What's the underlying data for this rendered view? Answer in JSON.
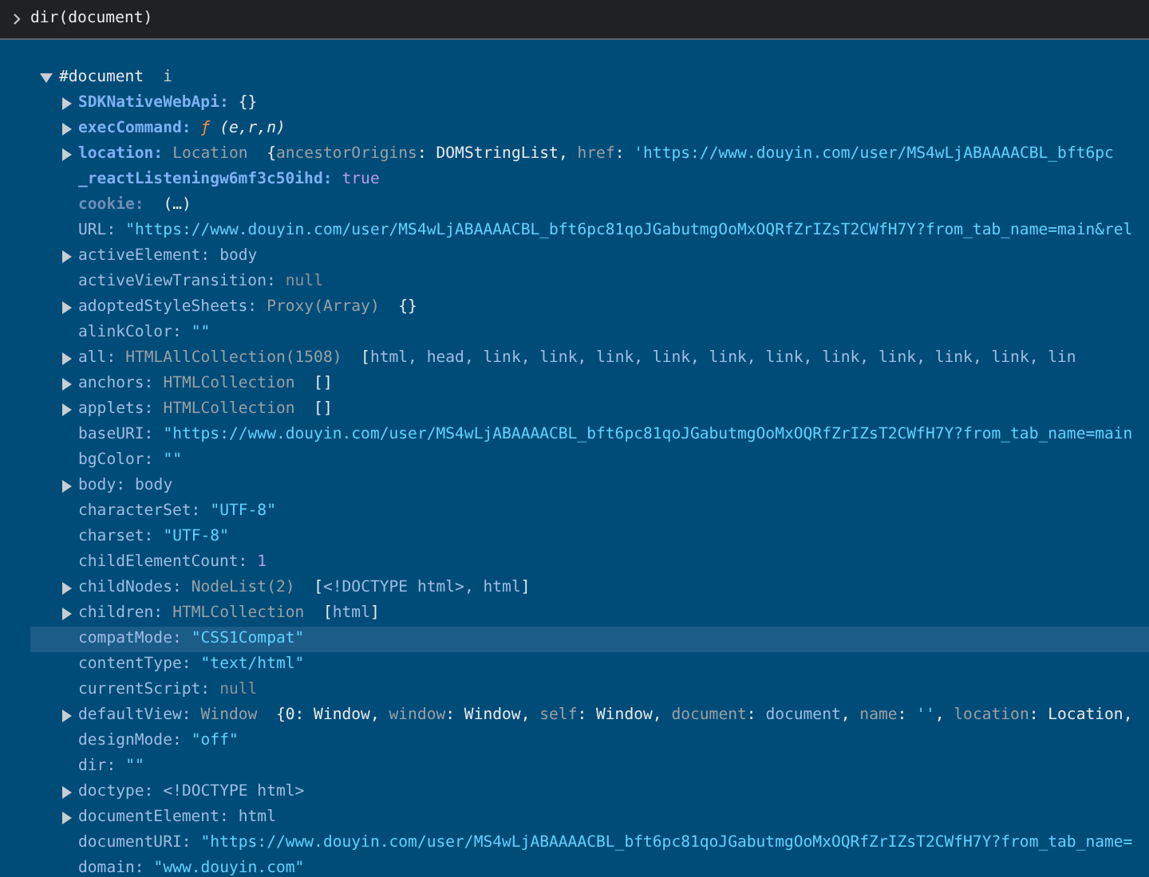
{
  "console_input": {
    "text": "dir(document)"
  },
  "root": {
    "label": "#document",
    "info": "i",
    "expanded": true,
    "properties": [
      {
        "key": "SDKNativeWebApi:",
        "kind": "own",
        "expandable": true,
        "selected": false,
        "value": [
          {
            "kind": "text",
            "text": "{}"
          }
        ]
      },
      {
        "key": "execCommand:",
        "kind": "own",
        "expandable": true,
        "selected": false,
        "value": [
          {
            "kind": "fn",
            "text": "ƒ"
          },
          {
            "kind": "params",
            "text": " (e,r,n)"
          }
        ]
      },
      {
        "key": "location:",
        "kind": "own",
        "expandable": true,
        "selected": false,
        "value": [
          {
            "kind": "class",
            "text": "Location"
          },
          {
            "kind": "text",
            "text": "  {"
          },
          {
            "kind": "key",
            "text": "ancestorOrigins"
          },
          {
            "kind": "text",
            "text": ": DOMStringList, "
          },
          {
            "kind": "key",
            "text": "href"
          },
          {
            "kind": "text",
            "text": ": "
          },
          {
            "kind": "str",
            "text": "'https://www.douyin.com/user/MS4wLjABAAAACBL_bft6pc"
          }
        ]
      },
      {
        "key": "_reactListeningw6mf3c50ihd:",
        "kind": "own",
        "expandable": false,
        "selected": false,
        "value": [
          {
            "kind": "num",
            "text": "true"
          }
        ]
      },
      {
        "key": "cookie:",
        "kind": "accessor",
        "expandable": false,
        "selected": false,
        "value": [
          {
            "kind": "text",
            "text": " (…)"
          }
        ]
      },
      {
        "key": "URL:",
        "kind": "inherited",
        "expandable": false,
        "selected": false,
        "value": [
          {
            "kind": "str",
            "text": "\"https://www.douyin.com/user/MS4wLjABAAAACBL_bft6pc81qoJGabutmgOoMxOQRfZrIZsT2CWfH7Y?from_tab_name=main&rel"
          }
        ]
      },
      {
        "key": "activeElement:",
        "kind": "inherited",
        "expandable": true,
        "selected": false,
        "value": [
          {
            "kind": "ref",
            "text": "body"
          }
        ]
      },
      {
        "key": "activeViewTransition:",
        "kind": "inherited",
        "expandable": false,
        "selected": false,
        "value": [
          {
            "kind": "null",
            "text": "null"
          }
        ]
      },
      {
        "key": "adoptedStyleSheets:",
        "kind": "inherited",
        "expandable": true,
        "selected": false,
        "value": [
          {
            "kind": "class",
            "text": "Proxy(Array)"
          },
          {
            "kind": "text",
            "text": "  {}"
          }
        ]
      },
      {
        "key": "alinkColor:",
        "kind": "inherited",
        "expandable": false,
        "selected": false,
        "value": [
          {
            "kind": "str",
            "text": "\"\""
          }
        ]
      },
      {
        "key": "all:",
        "kind": "inherited",
        "expandable": true,
        "selected": false,
        "value": [
          {
            "kind": "class",
            "text": "HTMLAllCollection(1508)"
          },
          {
            "kind": "text",
            "text": "  ["
          },
          {
            "kind": "ref",
            "text": "html, head, link, link, link, link, link, link, link, link, link, link, lin"
          }
        ]
      },
      {
        "key": "anchors:",
        "kind": "inherited",
        "expandable": true,
        "selected": false,
        "value": [
          {
            "kind": "class",
            "text": "HTMLCollection"
          },
          {
            "kind": "text",
            "text": "  []"
          }
        ]
      },
      {
        "key": "applets:",
        "kind": "inherited",
        "expandable": true,
        "selected": false,
        "value": [
          {
            "kind": "class",
            "text": "HTMLCollection"
          },
          {
            "kind": "text",
            "text": "  []"
          }
        ]
      },
      {
        "key": "baseURI:",
        "kind": "inherited",
        "expandable": false,
        "selected": false,
        "value": [
          {
            "kind": "str",
            "text": "\"https://www.douyin.com/user/MS4wLjABAAAACBL_bft6pc81qoJGabutmgOoMxOQRfZrIZsT2CWfH7Y?from_tab_name=main"
          }
        ]
      },
      {
        "key": "bgColor:",
        "kind": "inherited",
        "expandable": false,
        "selected": false,
        "value": [
          {
            "kind": "str",
            "text": "\"\""
          }
        ]
      },
      {
        "key": "body:",
        "kind": "inherited",
        "expandable": true,
        "selected": false,
        "value": [
          {
            "kind": "ref",
            "text": "body"
          }
        ]
      },
      {
        "key": "characterSet:",
        "kind": "inherited",
        "expandable": false,
        "selected": false,
        "value": [
          {
            "kind": "str",
            "text": "\"UTF-8\""
          }
        ]
      },
      {
        "key": "charset:",
        "kind": "inherited",
        "expandable": false,
        "selected": false,
        "value": [
          {
            "kind": "str",
            "text": "\"UTF-8\""
          }
        ]
      },
      {
        "key": "childElementCount:",
        "kind": "inherited",
        "expandable": false,
        "selected": false,
        "value": [
          {
            "kind": "num",
            "text": "1"
          }
        ]
      },
      {
        "key": "childNodes:",
        "kind": "inherited",
        "expandable": true,
        "selected": false,
        "value": [
          {
            "kind": "class",
            "text": "NodeList(2)"
          },
          {
            "kind": "text",
            "text": "  ["
          },
          {
            "kind": "ref",
            "text": "<!DOCTYPE html>, html"
          },
          {
            "kind": "text",
            "text": "]"
          }
        ]
      },
      {
        "key": "children:",
        "kind": "inherited",
        "expandable": true,
        "selected": false,
        "value": [
          {
            "kind": "class",
            "text": "HTMLCollection"
          },
          {
            "kind": "text",
            "text": "  ["
          },
          {
            "kind": "ref",
            "text": "html"
          },
          {
            "kind": "text",
            "text": "]"
          }
        ]
      },
      {
        "key": "compatMode:",
        "kind": "inherited",
        "expandable": false,
        "selected": true,
        "value": [
          {
            "kind": "str",
            "text": "\"CSS1Compat\""
          }
        ]
      },
      {
        "key": "contentType:",
        "kind": "inherited",
        "expandable": false,
        "selected": false,
        "value": [
          {
            "kind": "str",
            "text": "\"text/html\""
          }
        ]
      },
      {
        "key": "currentScript:",
        "kind": "inherited",
        "expandable": false,
        "selected": false,
        "value": [
          {
            "kind": "null",
            "text": "null"
          }
        ]
      },
      {
        "key": "defaultView:",
        "kind": "inherited",
        "expandable": true,
        "selected": false,
        "value": [
          {
            "kind": "class",
            "text": "Window"
          },
          {
            "kind": "text",
            "text": "  {0: Window, "
          },
          {
            "kind": "key",
            "text": "window"
          },
          {
            "kind": "text",
            "text": ": Window, "
          },
          {
            "kind": "key",
            "text": "self"
          },
          {
            "kind": "text",
            "text": ": Window, "
          },
          {
            "kind": "key",
            "text": "document"
          },
          {
            "kind": "text",
            "text": ": "
          },
          {
            "kind": "ref",
            "text": "document"
          },
          {
            "kind": "text",
            "text": ", "
          },
          {
            "kind": "key",
            "text": "name"
          },
          {
            "kind": "text",
            "text": ": "
          },
          {
            "kind": "str",
            "text": "''"
          },
          {
            "kind": "text",
            "text": ", "
          },
          {
            "kind": "key",
            "text": "location"
          },
          {
            "kind": "text",
            "text": ": Location,"
          }
        ]
      },
      {
        "key": "designMode:",
        "kind": "inherited",
        "expandable": false,
        "selected": false,
        "value": [
          {
            "kind": "str",
            "text": "\"off\""
          }
        ]
      },
      {
        "key": "dir:",
        "kind": "inherited",
        "expandable": false,
        "selected": false,
        "value": [
          {
            "kind": "str",
            "text": "\"\""
          }
        ]
      },
      {
        "key": "doctype:",
        "kind": "inherited",
        "expandable": true,
        "selected": false,
        "value": [
          {
            "kind": "ref",
            "text": "<!DOCTYPE html>"
          }
        ]
      },
      {
        "key": "documentElement:",
        "kind": "inherited",
        "expandable": true,
        "selected": false,
        "value": [
          {
            "kind": "ref",
            "text": "html"
          }
        ]
      },
      {
        "key": "documentURI:",
        "kind": "inherited",
        "expandable": false,
        "selected": false,
        "value": [
          {
            "kind": "str",
            "text": "\"https://www.douyin.com/user/MS4wLjABAAAACBL_bft6pc81qoJGabutmgOoMxOQRfZrIZsT2CWfH7Y?from_tab_name="
          }
        ]
      },
      {
        "key": "domain:",
        "kind": "inherited",
        "expandable": false,
        "selected": false,
        "value": [
          {
            "kind": "str",
            "text": "\"www.douyin.com\""
          }
        ]
      }
    ]
  }
}
